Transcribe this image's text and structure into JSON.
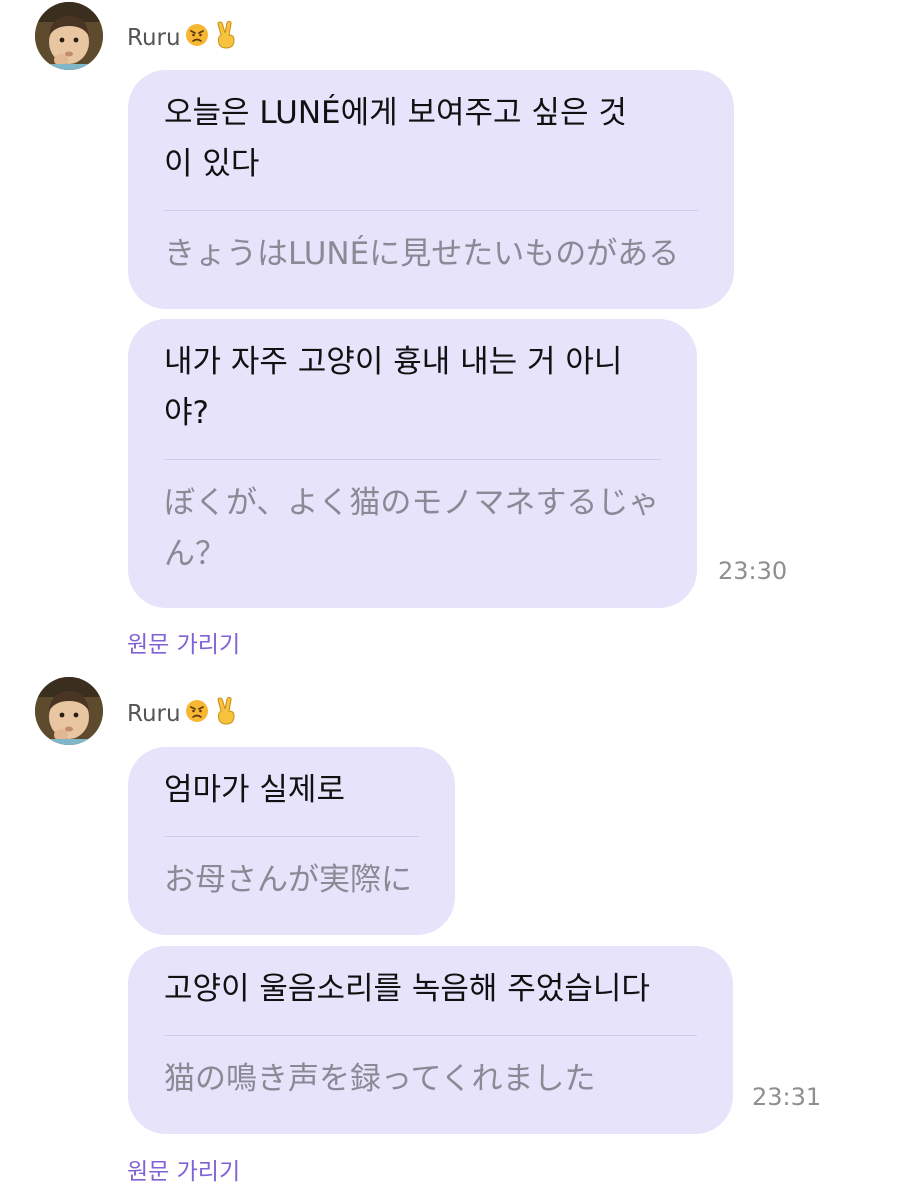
{
  "groups": [
    {
      "sender": {
        "name": "Ruru",
        "badges": [
          "angry-face-emoji",
          "victory-hand-emoji"
        ]
      },
      "messages": [
        {
          "original": "오늘은 LUNÉ에게 보여주고 싶은 것\n이 있다",
          "translation": "きょうはLUNÉに見せたいものがある",
          "time": ""
        },
        {
          "original": "내가 자주 고양이 흉내 내는 거 아니\n야?",
          "translation": "ぼくが、よく猫のモノマネするじゃ\nん？",
          "time": "23:30"
        }
      ],
      "hide_original_label": "원문 가리기"
    },
    {
      "sender": {
        "name": "Ruru",
        "badges": [
          "angry-face-emoji",
          "victory-hand-emoji"
        ]
      },
      "messages": [
        {
          "original": "엄마가 실제로",
          "translation": "お母さんが実際に",
          "time": ""
        },
        {
          "original": "고양이 울음소리를 녹음해 주었습니다",
          "translation": "猫の鳴き声を録ってくれました",
          "time": "23:31"
        }
      ],
      "hide_original_label": "원문 가리기"
    }
  ],
  "colors": {
    "bubble": "#e6e3fb",
    "link": "#7f62d6",
    "translation_text": "#8a8a95",
    "timestamp": "#8e8e93"
  }
}
